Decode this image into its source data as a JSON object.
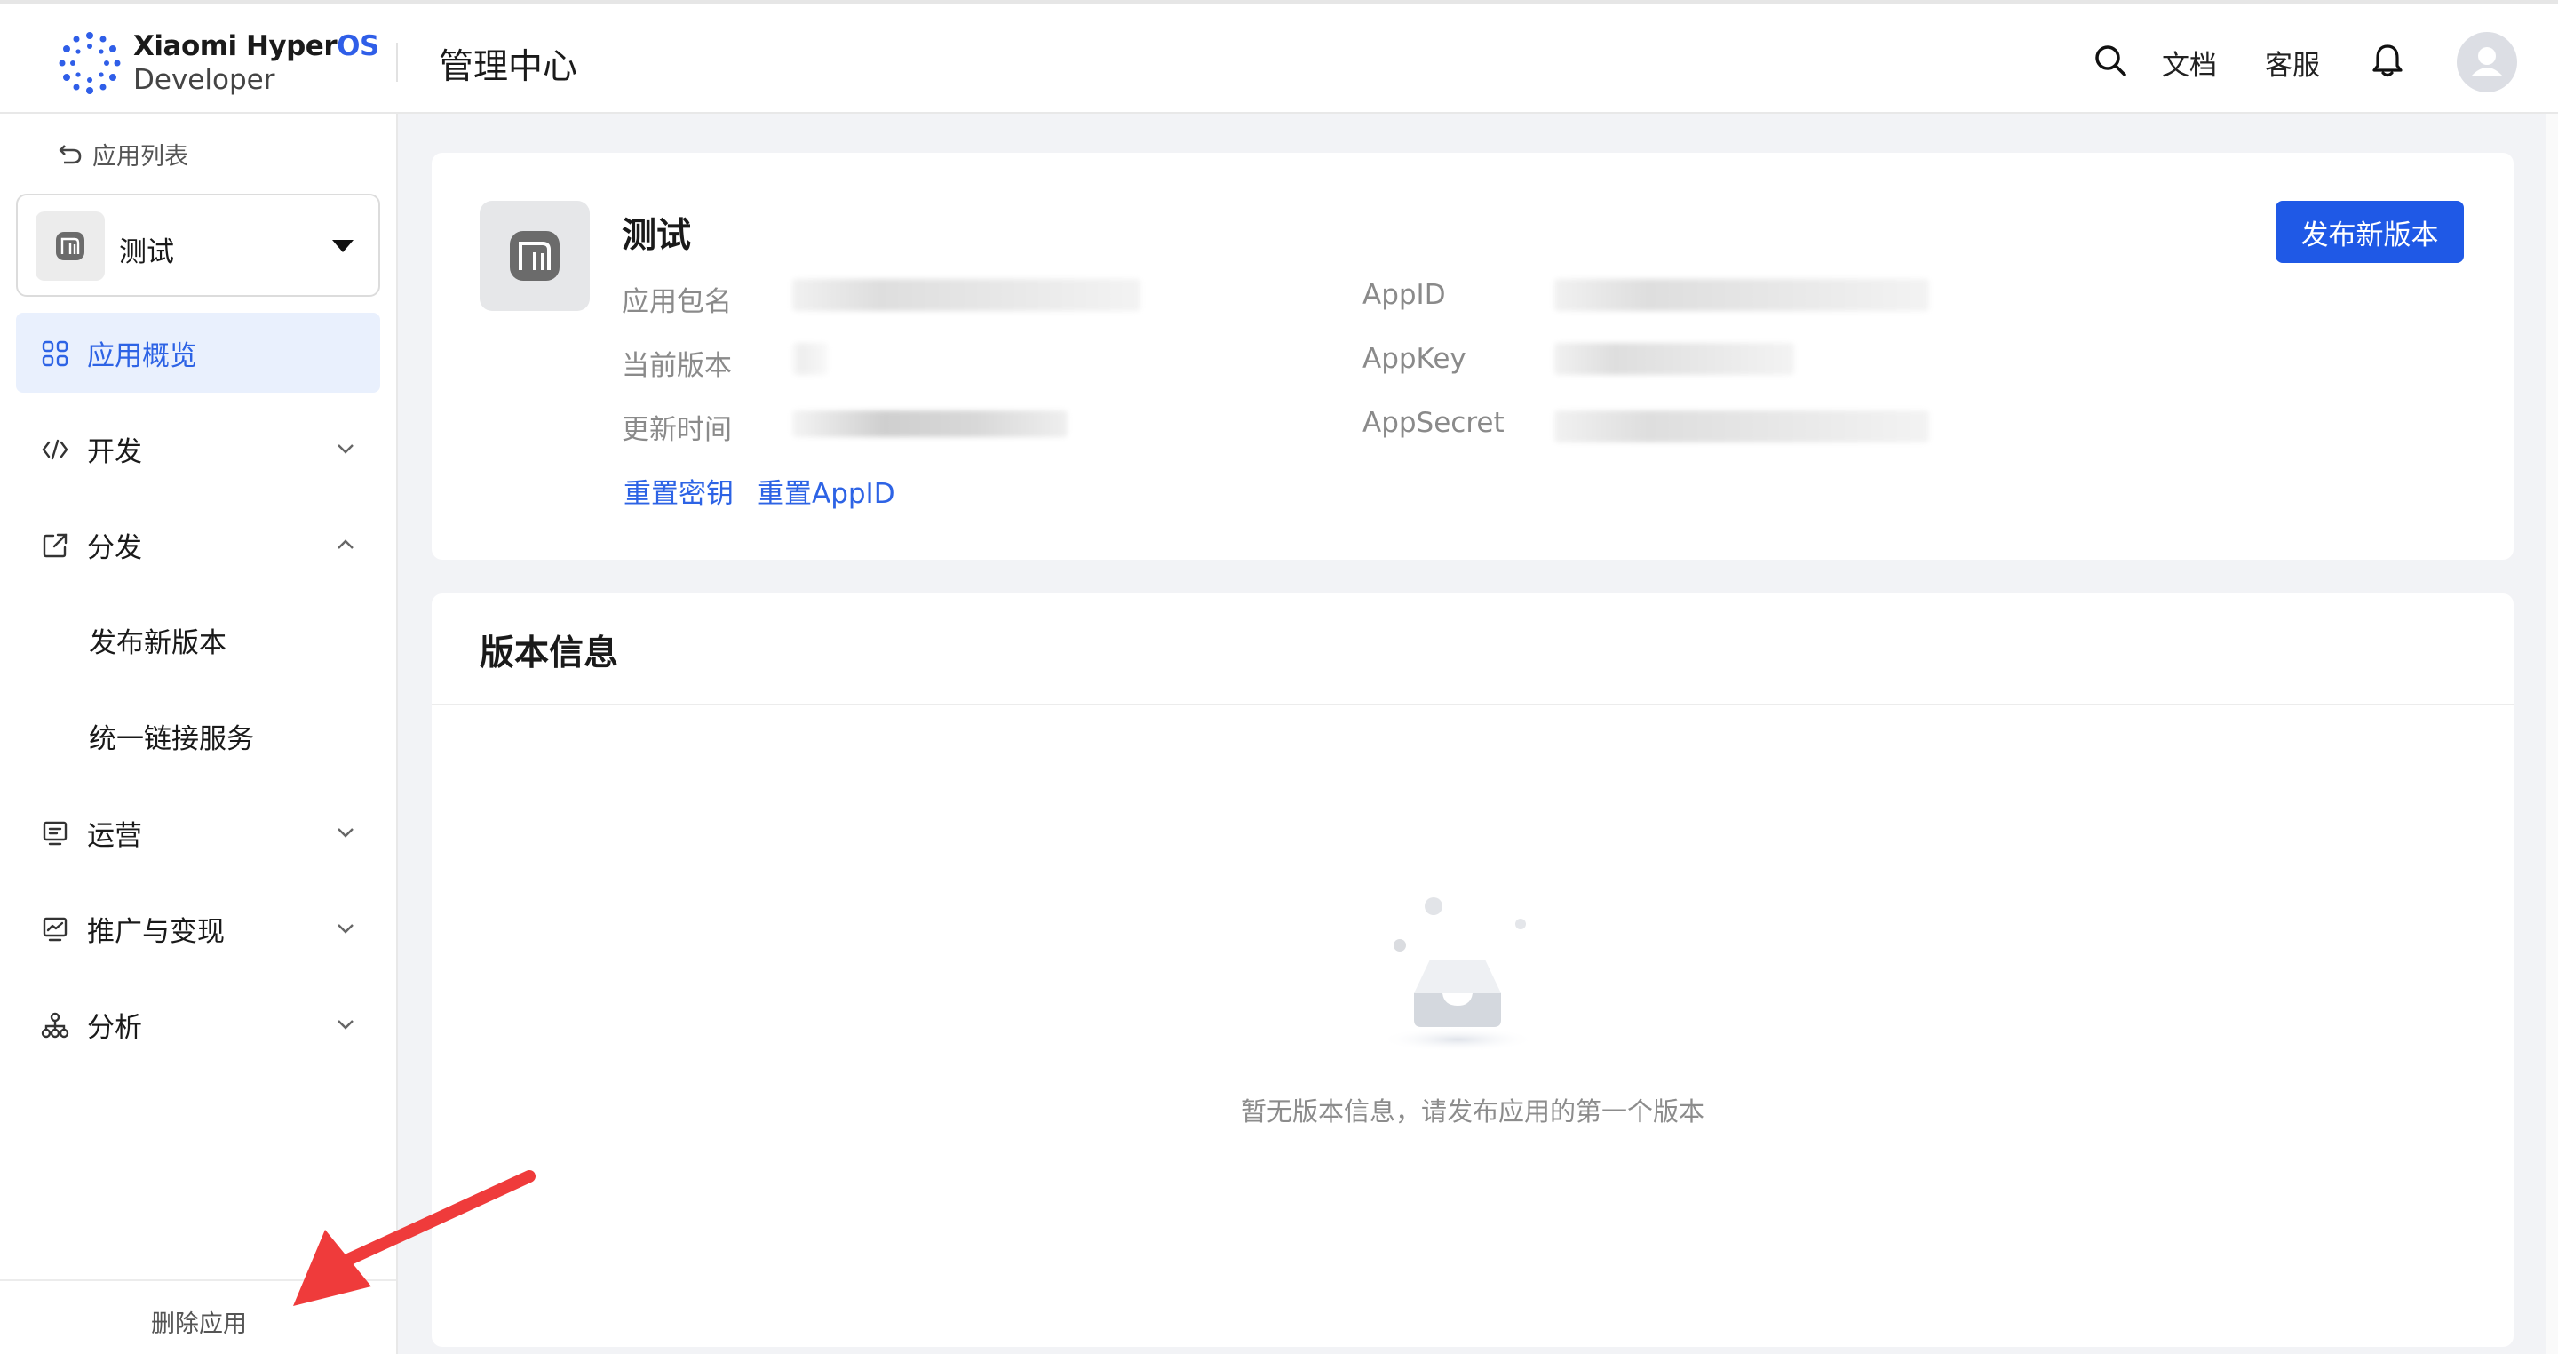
{
  "header": {
    "brand_line1": "Xiaomi Hyper",
    "brand_line1_accent": "OS",
    "brand_line2": "Developer",
    "title": "管理中心",
    "links": {
      "docs": "文档",
      "support": "客服"
    },
    "icons": [
      "search-icon",
      "bell-icon",
      "avatar-icon"
    ]
  },
  "sidebar": {
    "back_label": "应用列表",
    "app_selector": {
      "name": "测试"
    },
    "nav": [
      {
        "label": "应用概览",
        "icon": "grid-icon",
        "active": true
      },
      {
        "label": "开发",
        "icon": "code-icon",
        "expanded": false
      },
      {
        "label": "分发",
        "icon": "share-icon",
        "expanded": true,
        "children": [
          "发布新版本",
          "统一链接服务"
        ]
      },
      {
        "label": "运营",
        "icon": "monitor-icon",
        "expanded": false
      },
      {
        "label": "推广与变现",
        "icon": "chart-icon",
        "expanded": false
      },
      {
        "label": "分析",
        "icon": "hierarchy-icon",
        "expanded": false
      }
    ],
    "footer": {
      "delete_label": "删除应用"
    }
  },
  "app_card": {
    "app_name": "测试",
    "fields_left": [
      {
        "label": "应用包名"
      },
      {
        "label": "当前版本"
      },
      {
        "label": "更新时间"
      }
    ],
    "fields_right": [
      {
        "label": "AppID"
      },
      {
        "label": "AppKey"
      },
      {
        "label": "AppSecret"
      }
    ],
    "actions": {
      "reset_key": "重置密钥",
      "reset_appid": "重置AppID"
    },
    "publish_button": "发布新版本"
  },
  "version_card": {
    "title": "版本信息",
    "empty_text": "暂无版本信息，请发布应用的第一个版本"
  },
  "colors": {
    "accent": "#2d63e5",
    "primary_button": "#1f59e6",
    "annotation_arrow": "#ef3b3b"
  }
}
